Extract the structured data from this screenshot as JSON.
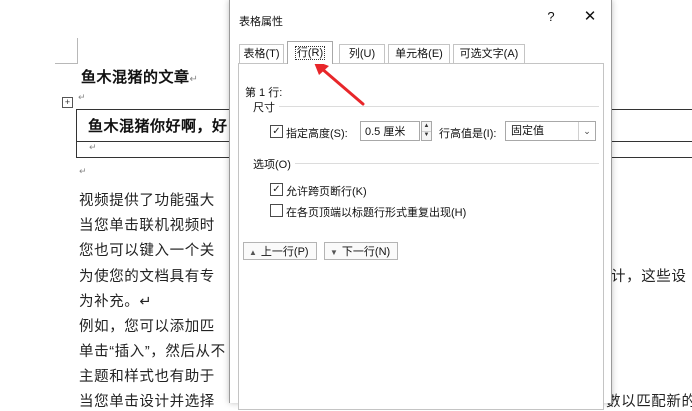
{
  "document": {
    "title": "鱼木混猪的文章",
    "para_mark": "↵",
    "table_cell_text": "鱼木混猪你好啊，好",
    "move_handle": "+",
    "body_lines": [
      "视频提供了功能强大",
      "当您单击联机视频时",
      "您也可以键入一个关",
      "为使您的文档具有专",
      "为补充。↵",
      "例如，您可以添加匹",
      "单击“插入”，然后从不",
      "主题和样式也有助于",
      "当您单击设计并选择"
    ],
    "right_fragments": [
      "计，这些设",
      "數以匹配新的"
    ]
  },
  "dialog": {
    "title": "表格属性",
    "help": "?",
    "close": "✕",
    "tabs": [
      {
        "label": "表格(T)"
      },
      {
        "label": "行(R)"
      },
      {
        "label": "列(U)"
      },
      {
        "label": "单元格(E)"
      },
      {
        "label": "可选文字(A)"
      }
    ],
    "active_tab": "行(R)",
    "row_label": "第 1 行:",
    "size_section": "尺寸",
    "specify_height_label": "指定高度(S):",
    "specify_height_checked": "✓",
    "height_value": "0.5 厘米",
    "row_height_is_label": "行高值是(I):",
    "row_height_mode": "固定值",
    "options_section": "选项(O)",
    "allow_break_label": "允许跨页断行(K)",
    "allow_break_checked": "✓",
    "repeat_header_label": "在各页顶端以标题行形式重复出现(H)",
    "repeat_header_checked": "",
    "prev_row_button": "上一行(P)",
    "next_row_button": "下一行(N)"
  },
  "colors": {
    "annotation_arrow": "#e8262a"
  }
}
